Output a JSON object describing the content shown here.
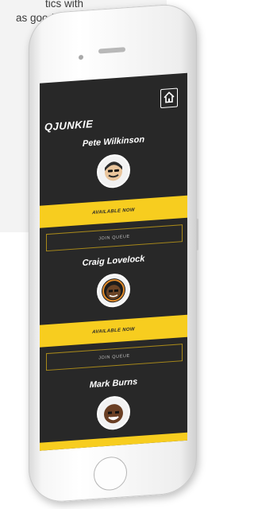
{
  "page": {
    "text_line1": "tics with",
    "text_line2": "as good as it"
  },
  "app": {
    "logo": "QJUNKIE",
    "home_icon": "home-icon"
  },
  "people": [
    {
      "name": "Pete Wilkinson",
      "available_label": "AVAILABLE NOW",
      "join_label": "JOIN QUEUE"
    },
    {
      "name": "Craig Lovelock",
      "available_label": "AVAILABLE NOW",
      "join_label": "JOIN QUEUE"
    },
    {
      "name": "Mark Burns"
    }
  ],
  "colors": {
    "accent_yellow": "#f7cd1f",
    "screen_bg": "#282828"
  }
}
